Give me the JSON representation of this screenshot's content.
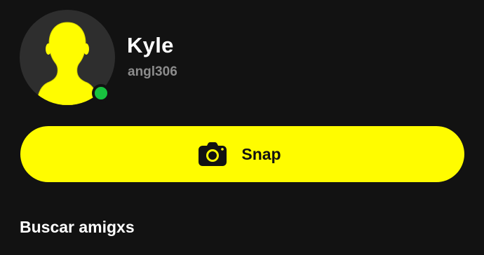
{
  "profile": {
    "display_name": "Kyle",
    "username": "angl306",
    "online": true
  },
  "actions": {
    "snap_label": "Snap"
  },
  "sections": {
    "find_friends_title": "Buscar amigxs"
  },
  "colors": {
    "background": "#121212",
    "accent_yellow": "#fffc00",
    "online_green": "#18c33f",
    "username_gray": "#8c8c8c",
    "avatar_bg": "#2e2e2e"
  },
  "icons": {
    "avatar": "bitmoji-silhouette-icon",
    "snap": "camera-icon",
    "status": "online-status-icon"
  }
}
